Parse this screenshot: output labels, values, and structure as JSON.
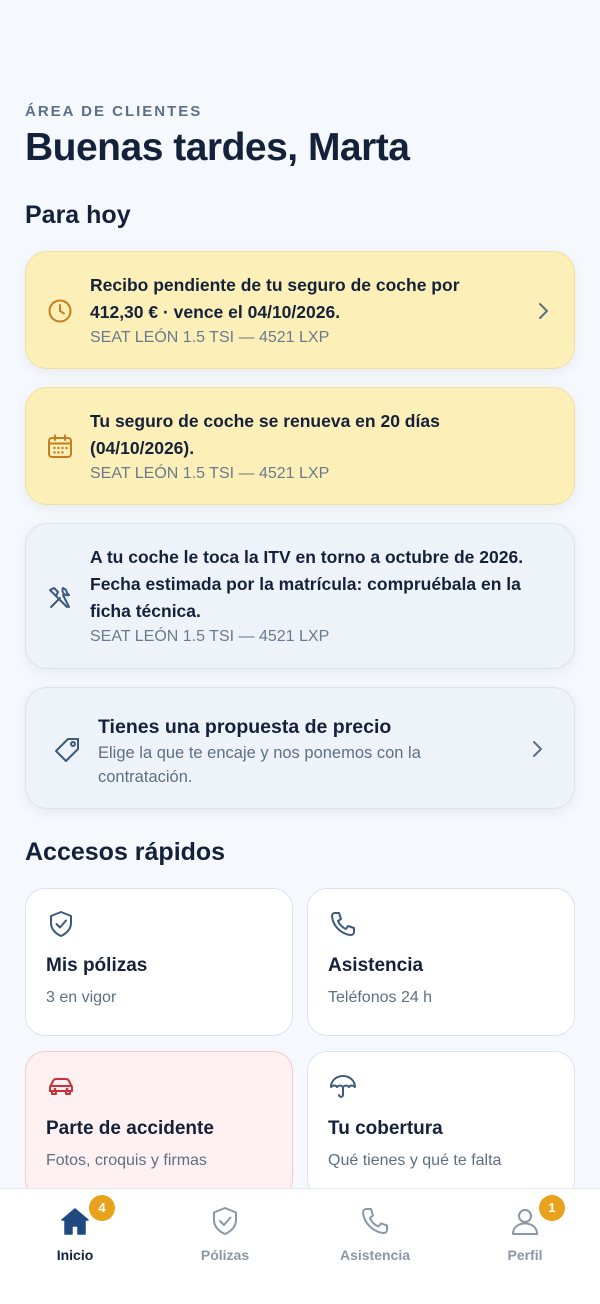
{
  "header": {
    "eyebrow": "ÁREA DE CLIENTES",
    "greeting": "Buenas tardes, Marta"
  },
  "today": {
    "title": "Para hoy",
    "cards": [
      {
        "icon": "clock-icon",
        "main_line1": "Recibo pendiente de tu seguro de coche por",
        "main_line2": "412,30 € · vence el 04/10/2026.",
        "car": "SEAT LEÓN 1.5 TSI — 4521 LXP"
      },
      {
        "icon": "calendar-icon",
        "main_line1": "Tu seguro de coche se renueva en 20 días",
        "main_line2": "(04/10/2026).",
        "car": "SEAT LEÓN 1.5 TSI — 4521 LXP"
      },
      {
        "icon": "tools-icon",
        "main_line1": "A tu coche le toca la ITV en torno a octubre de 2026.",
        "main_line2": "Fecha estimada por la matrícula: compruébala en la",
        "main_line3": "ficha técnica.",
        "car": "SEAT LEÓN 1.5 TSI — 4521 LXP"
      },
      {
        "icon": "tag-icon",
        "title": "Tienes una propuesta de precio",
        "sub_line1": "Elige la que te encaje y nos ponemos con la",
        "sub_line2": "contratación."
      }
    ]
  },
  "quick": {
    "title": "Accesos rápidos",
    "items": [
      {
        "icon": "shield-check-icon",
        "title": "Mis pólizas",
        "sub": "3 en vigor"
      },
      {
        "icon": "phone-icon",
        "title": "Asistencia",
        "sub": "Teléfonos 24 h"
      },
      {
        "icon": "car-icon",
        "title": "Parte de accidente",
        "sub": "Fotos, croquis y firmas"
      },
      {
        "icon": "umbrella-icon",
        "title": "Tu cobertura",
        "sub": "Qué tienes y qué te falta"
      }
    ]
  },
  "nav": {
    "items": [
      {
        "icon": "home-icon",
        "label": "Inicio",
        "badge": "4"
      },
      {
        "icon": "shield-check-icon",
        "label": "Pólizas"
      },
      {
        "icon": "phone-icon",
        "label": "Asistencia"
      },
      {
        "icon": "user-icon",
        "label": "Perfil",
        "badge": "1"
      }
    ]
  },
  "colors": {
    "warn_card": "#fdefb8",
    "info_card": "#eef3f9",
    "badge": "#e9a21c",
    "accent_red": "#c8323a",
    "icon_orange": "#c77d1a",
    "icon_blue": "#3b5a7d"
  }
}
